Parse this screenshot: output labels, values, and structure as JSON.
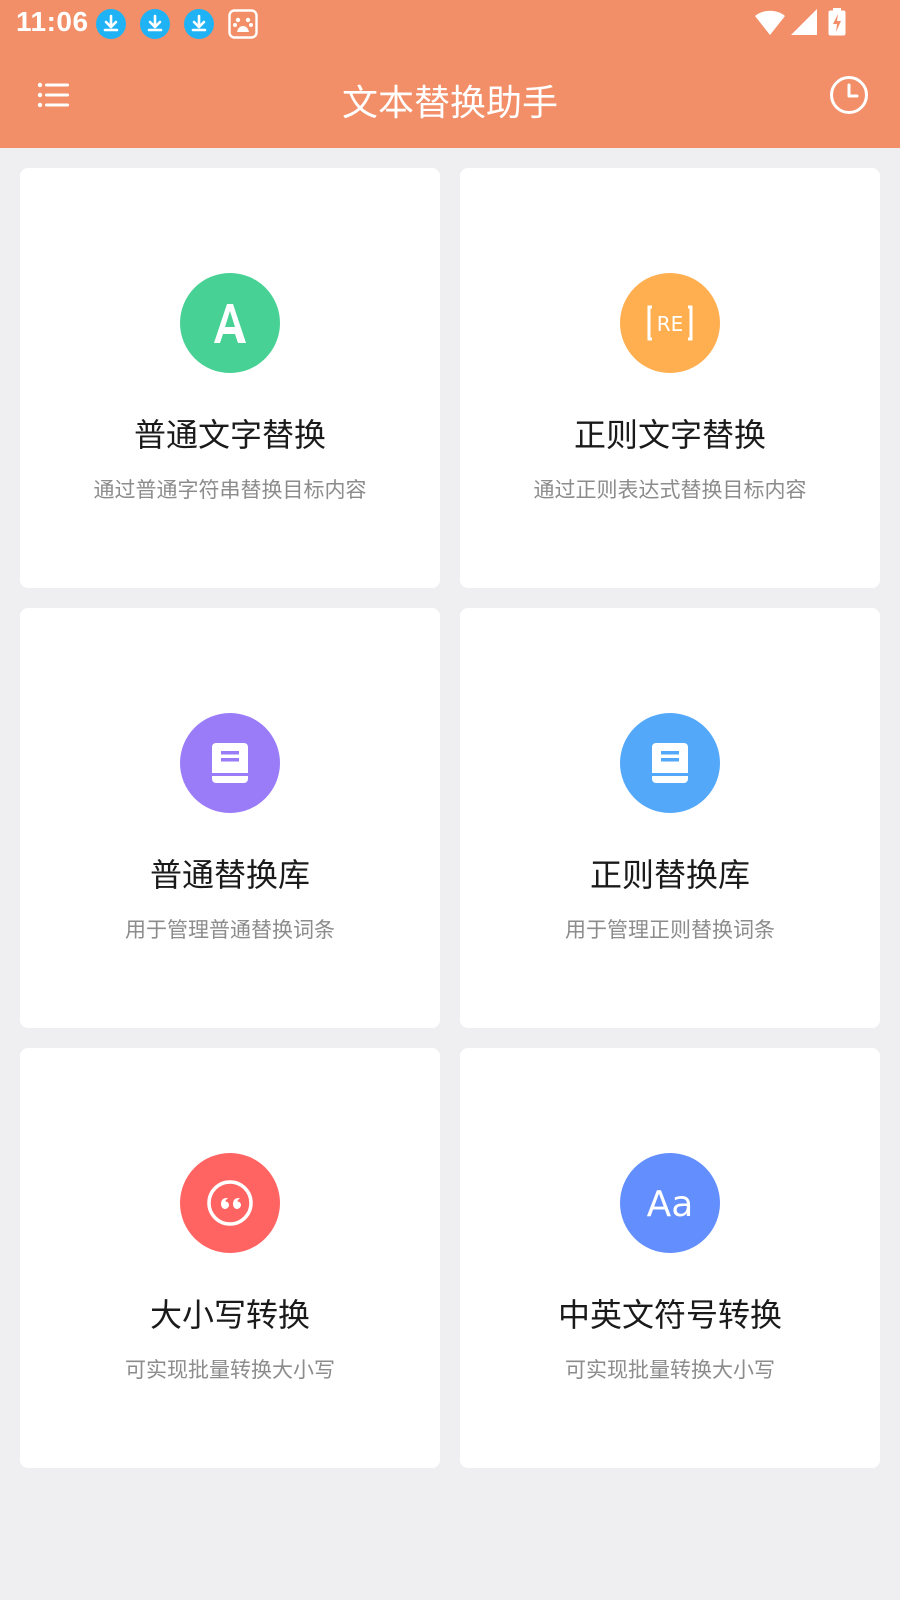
{
  "status_bar": {
    "time": "11:06",
    "notifications": [
      "download-icon",
      "download-icon",
      "download-icon",
      "baidu-paw-icon"
    ],
    "system_icons": [
      "wifi-icon",
      "signal-icon",
      "battery-charging-icon"
    ]
  },
  "app_bar": {
    "title": "文本替换助手",
    "left_icon": "menu-list-icon",
    "right_icon": "history-clock-icon"
  },
  "colors": {
    "accent": "#f28f68",
    "background": "#efeff1",
    "green": "#48d195",
    "orange": "#ffaf50",
    "purple": "#9a7cf8",
    "blue": "#53a8fa",
    "red": "#ff6462",
    "indigo": "#628efe"
  },
  "cards": [
    {
      "title": "普通文字替换",
      "description": "通过普通字符串替换目标内容",
      "icon": "letter-a-icon",
      "icon_color": "#48d195"
    },
    {
      "title": "正则文字替换",
      "description": "通过正则表达式替换目标内容",
      "icon": "regex-icon",
      "icon_color": "#ffaf50"
    },
    {
      "title": "普通替换库",
      "description": "用于管理普通替换词条",
      "icon": "book-icon",
      "icon_color": "#9a7cf8"
    },
    {
      "title": "正则替换库",
      "description": "用于管理正则替换词条",
      "icon": "book-icon",
      "icon_color": "#53a8fa"
    },
    {
      "title": "大小写转换",
      "description": "可实现批量转换大小写",
      "icon": "quote-icon",
      "icon_color": "#ff6462"
    },
    {
      "title": "中英文符号转换",
      "description": "可实现批量转换大小写",
      "icon": "aa-text-icon",
      "icon_color": "#628efe"
    }
  ]
}
